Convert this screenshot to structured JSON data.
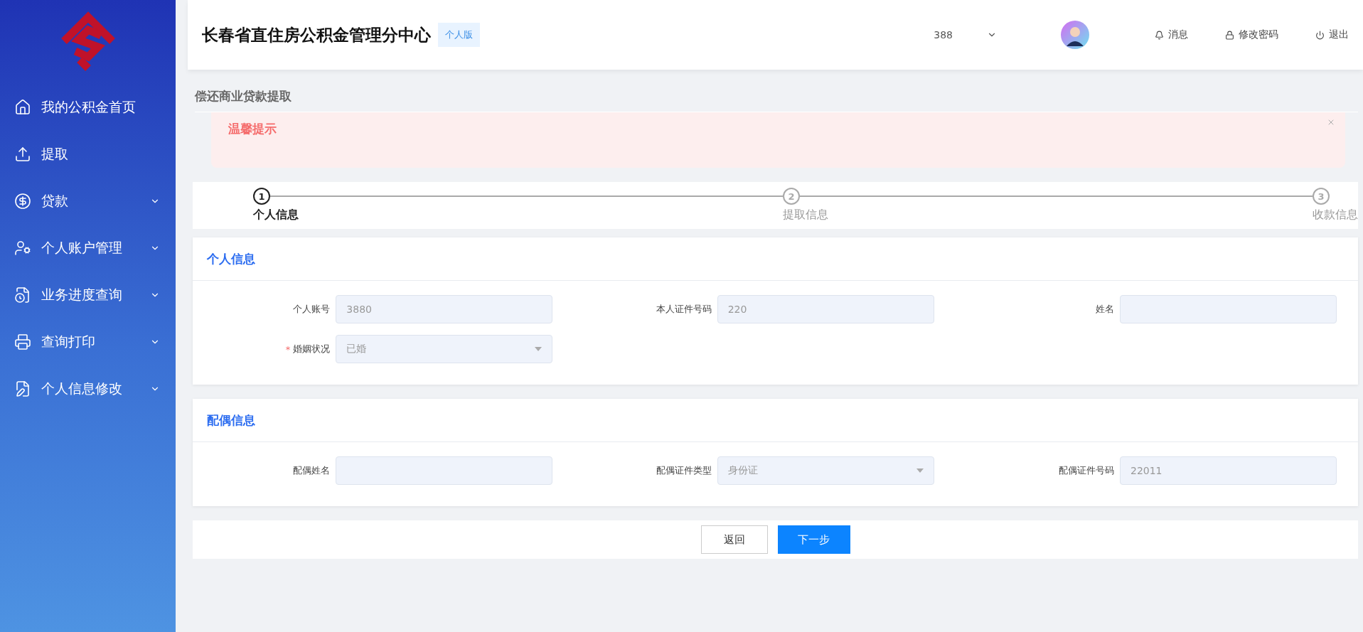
{
  "sidebar": {
    "items": [
      {
        "label": "我的公积金首页",
        "kind": "link"
      },
      {
        "label": "提取",
        "kind": "link"
      },
      {
        "label": "贷款",
        "kind": "submenu"
      },
      {
        "label": "个人账户管理",
        "kind": "submenu"
      },
      {
        "label": "业务进度查询",
        "kind": "submenu"
      },
      {
        "label": "查询打印",
        "kind": "submenu"
      },
      {
        "label": "个人信息修改",
        "kind": "submenu"
      }
    ]
  },
  "header": {
    "title": "长春省直住房公积金管理分中心",
    "badge": "个人版",
    "user": "388",
    "links": [
      {
        "label": "消息"
      },
      {
        "label": "修改密码"
      },
      {
        "label": "退出"
      }
    ]
  },
  "page_title": "偿还商业贷款提取",
  "alert": {
    "title": "温馨提示"
  },
  "steps": [
    {
      "number": "1",
      "label": "个人信息",
      "selected": true
    },
    {
      "number": "2",
      "label": "提取信息",
      "selected": false
    },
    {
      "number": "3",
      "label": "收款信息",
      "selected": false
    }
  ],
  "sections": [
    {
      "title": "个人信息",
      "fields": [
        {
          "label": "个人账号",
          "value": "3880",
          "kind": "input"
        },
        {
          "label": "本人证件号码",
          "value": "220",
          "kind": "input"
        },
        {
          "label": "姓名",
          "kind": "input"
        },
        {
          "label": "婚姻状况",
          "value": "已婚",
          "kind": "select",
          "required_mark": "*"
        }
      ]
    },
    {
      "title": "配偶信息",
      "fields": [
        {
          "label": "配偶姓名",
          "kind": "input"
        },
        {
          "label": "配偶证件类型",
          "value": "身份证",
          "kind": "select"
        },
        {
          "label": "配偶证件号码",
          "value": "22011",
          "kind": "input"
        }
      ]
    }
  ],
  "buttons": [
    {
      "label": "返回",
      "kind": "secondary"
    },
    {
      "label": "下一步",
      "kind": "primary"
    }
  ]
}
